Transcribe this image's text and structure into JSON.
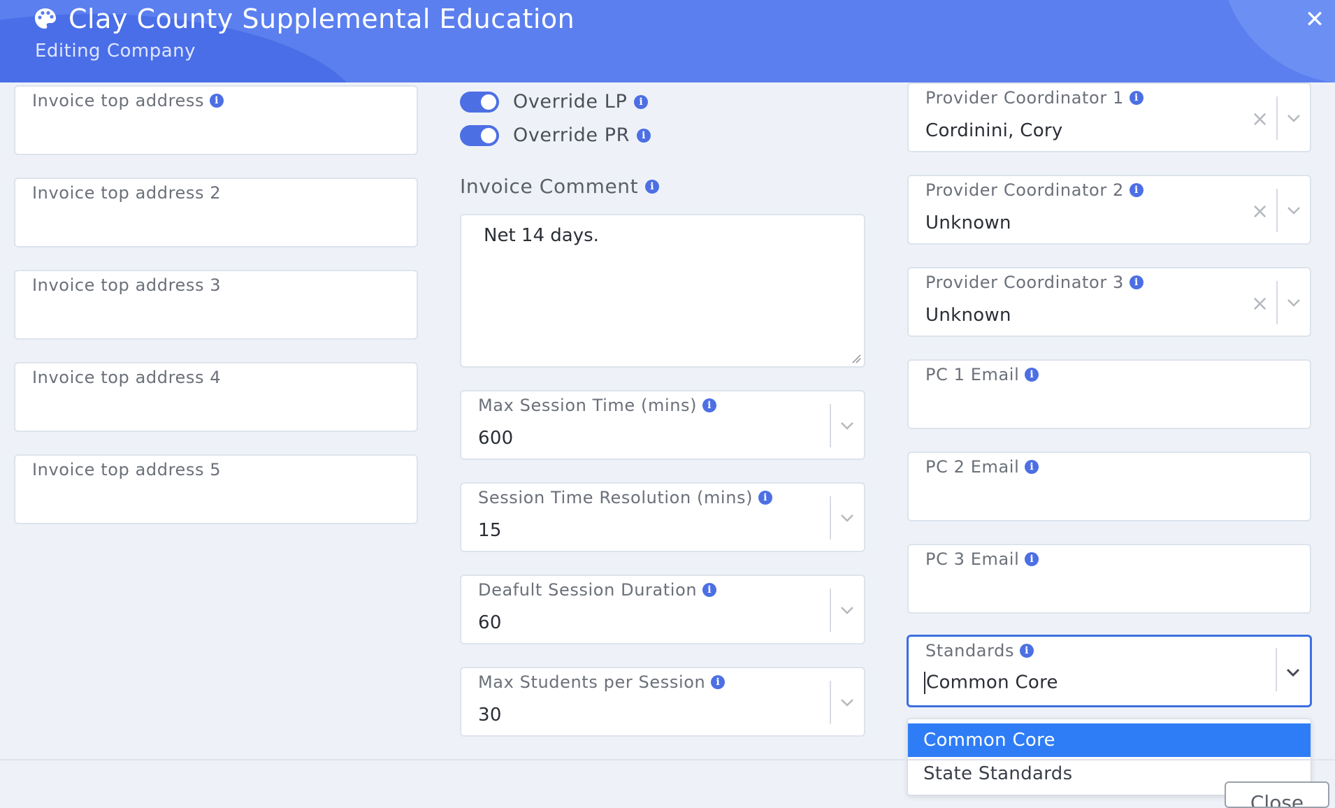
{
  "header": {
    "title": "Clay County Supplemental Education",
    "subtitle": "Editing Company",
    "close_glyph": "✕",
    "icon": "palette-icon"
  },
  "left_column": {
    "fields": [
      {
        "label": "Invoice top address",
        "value": "",
        "info": true
      },
      {
        "label": "Invoice top address 2",
        "value": "",
        "info": false
      },
      {
        "label": "Invoice top address 3",
        "value": "",
        "info": false
      },
      {
        "label": "Invoice top address 4",
        "value": "",
        "info": false
      },
      {
        "label": "Invoice top address 5",
        "value": "",
        "info": false
      }
    ]
  },
  "middle_column": {
    "toggles": [
      {
        "label": "Override LP",
        "on": true
      },
      {
        "label": "Override PR",
        "on": true
      }
    ],
    "invoice_comment": {
      "label": "Invoice Comment",
      "value": "Net 14 days."
    },
    "selects": [
      {
        "label": "Max Session Time (mins)",
        "value": "600"
      },
      {
        "label": "Session Time Resolution (mins)",
        "value": "15"
      },
      {
        "label": "Deafult Session Duration",
        "value": "60"
      },
      {
        "label": "Max Students per Session",
        "value": "30"
      }
    ]
  },
  "right_column": {
    "coordinators": [
      {
        "label": "Provider Coordinator 1",
        "value": "Cordinini, Cory"
      },
      {
        "label": "Provider Coordinator 2",
        "value": "Unknown"
      },
      {
        "label": "Provider Coordinator 3",
        "value": "Unknown"
      }
    ],
    "emails": [
      {
        "label": "PC 1 Email",
        "value": ""
      },
      {
        "label": "PC 2 Email",
        "value": ""
      },
      {
        "label": "PC 3 Email",
        "value": ""
      }
    ],
    "standards": {
      "label": "Standards",
      "value": "Common Core",
      "options": [
        "Common Core",
        "State Standards"
      ],
      "selected_index": 0
    }
  },
  "footer": {
    "close_label": "Close"
  },
  "colors": {
    "header_bg": "#5b7fee",
    "accent": "#4d6fe4",
    "selected_option": "#2f7df6",
    "focus_border": "#3b6fe0"
  }
}
